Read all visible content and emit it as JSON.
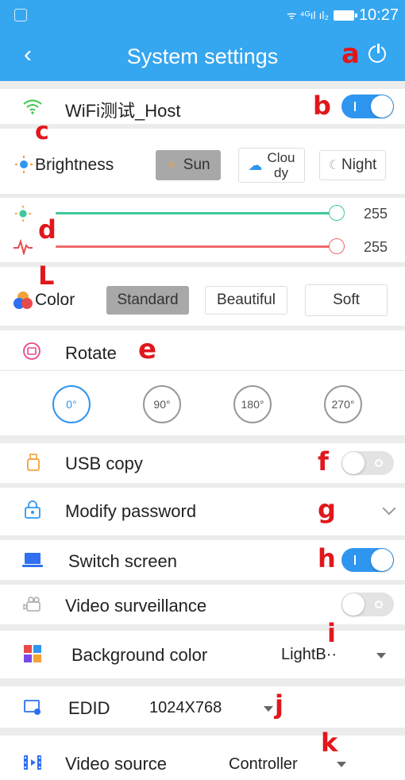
{
  "status_bar": {
    "time": "10:27",
    "signal": "ᯤ ⁴ᴳıl ıl₂"
  },
  "nav": {
    "back_label": "‹",
    "title": "System settings"
  },
  "annotations": {
    "a": "a",
    "b": "b",
    "c": "c",
    "d": "d",
    "L": "L",
    "e": "e",
    "f": "f",
    "g": "g",
    "h": "h",
    "i": "i",
    "j": "j",
    "k": "k"
  },
  "wifi": {
    "name": "WiFi测试_Host",
    "icon": "wifi-icon",
    "enabled": true
  },
  "brightness": {
    "label": "Brightness",
    "icon": "sun-icon",
    "modes": [
      {
        "label": "Sun",
        "active": true
      },
      {
        "label": "Clou\ndy",
        "active": false
      },
      {
        "label": "Night",
        "active": false
      }
    ]
  },
  "sliders": [
    {
      "icon": "sun-icon",
      "value": "255",
      "level": 1.0,
      "color": "#3cc89a"
    },
    {
      "icon": "pulse-icon",
      "value": "255",
      "level": 1.0,
      "color": "#f06a6a"
    }
  ],
  "color": {
    "label": "Color",
    "icon": "palette-icon",
    "options": [
      {
        "label": "Standard",
        "active": true
      },
      {
        "label": "Beautiful",
        "active": false
      },
      {
        "label": "Soft",
        "active": false
      }
    ]
  },
  "rotate": {
    "label": "Rotate",
    "icon": "rotate-image-icon",
    "options": [
      {
        "label": "0°",
        "active": true
      },
      {
        "label": "90°",
        "active": false
      },
      {
        "label": "180°",
        "active": false
      },
      {
        "label": "270°",
        "active": false
      }
    ]
  },
  "usb_copy": {
    "label": "USB copy",
    "icon": "usb-icon",
    "enabled": false
  },
  "modify_password": {
    "label": "Modify password",
    "icon": "lock-icon"
  },
  "switch_screen": {
    "label": "Switch screen",
    "icon": "laptop-icon",
    "enabled": true
  },
  "video_surveillance": {
    "label": "Video surveillance",
    "icon": "camera-icon",
    "enabled": false
  },
  "background_color": {
    "label": "Background color",
    "value": "LightB··",
    "icon": "grid-icon"
  },
  "edid": {
    "label": "EDID",
    "value": "1024X768",
    "icon": "monitor-icon"
  },
  "video_source": {
    "label": "Video source",
    "value": "Controller",
    "icon": "film-icon"
  },
  "colors": {
    "accent": "#35a6f0",
    "toggle_on": "#2f96f0",
    "annotation": "#e0171c"
  }
}
